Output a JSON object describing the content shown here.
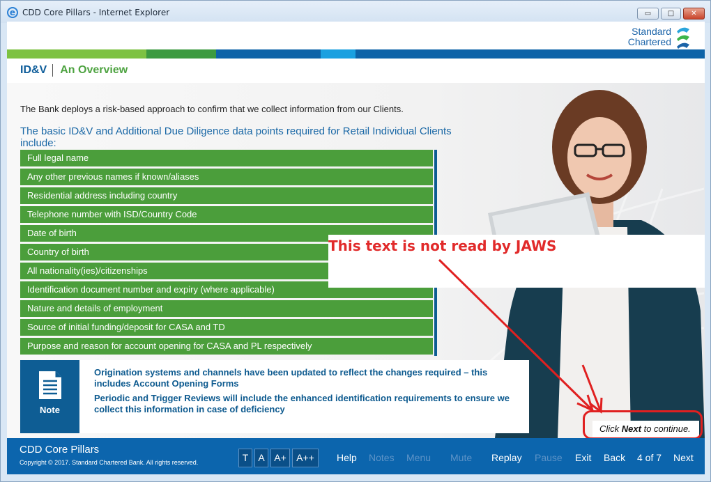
{
  "window": {
    "title": "CDD Core Pillars - Internet Explorer",
    "controls": {
      "minimize": "▭",
      "maximize": "□",
      "close": "✕"
    }
  },
  "logo": {
    "line1": "Standard",
    "line2": "Chartered"
  },
  "heading": {
    "section": "ID&V",
    "title": "An Overview"
  },
  "intro": "The Bank deploys a risk-based approach to confirm that we collect information from our Clients.",
  "lead": "The basic ID&V and Additional Due Diligence data points required for Retail Individual Clients include:",
  "data_points": [
    "Full legal name",
    "Any other previous names if known/aliases",
    "Residential address including country",
    "Telephone number with ISD/Country Code",
    "Date of birth",
    "Country of birth",
    "All nationality(ies)/citizenships",
    "Identification document number and expiry (where applicable)",
    "Nature and details of employment",
    "Source of initial funding/deposit for CASA and TD",
    "Purpose and reason for account opening for CASA and PL respectively"
  ],
  "annotation": {
    "text": "This text is not read by JAWS",
    "color": "#e12a2a"
  },
  "note": {
    "label": "Note",
    "icon": "document-icon",
    "paragraph1": "Origination systems and channels have been updated to reflect the changes required – this includes Account Opening Forms",
    "paragraph2": "Periodic and Trigger Reviews will include the enhanced identification requirements to ensure we collect this information in case of deficiency"
  },
  "continue": {
    "prefix": "Click ",
    "bold": "Next",
    "suffix": " to continue."
  },
  "footer": {
    "title": "CDD Core Pillars",
    "copyright": "Copyright © 2017. Standard Chartered Bank. All rights reserved.",
    "text_buttons": [
      "T",
      "A",
      "A+",
      "A++"
    ],
    "nav": {
      "help": "Help",
      "notes": "Notes",
      "menu": "Menu",
      "mute": "Mute",
      "replay": "Replay",
      "pause": "Pause",
      "exit": "Exit",
      "back": "Back",
      "page": "4 of 7",
      "next": "Next"
    }
  },
  "colors": {
    "brand_blue": "#0c65ad",
    "list_green": "#4b9e3b",
    "heading_green": "#4ea341",
    "annotation_red": "#e02020"
  }
}
